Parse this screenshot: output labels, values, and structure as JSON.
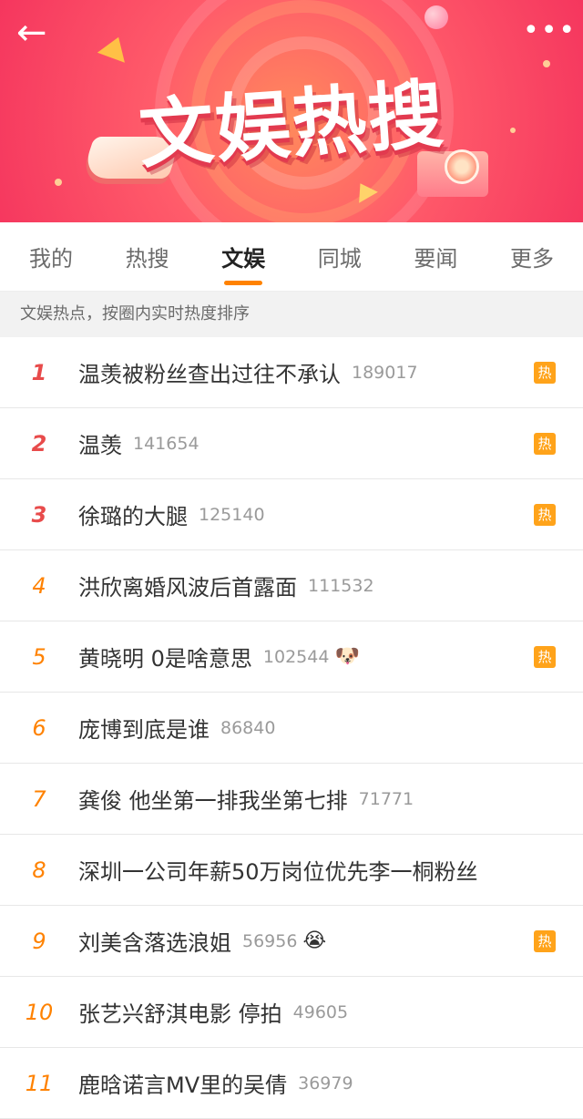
{
  "banner": {
    "title": "文娱热搜",
    "back_icon": "←",
    "more_icon": "•••"
  },
  "tabs": [
    {
      "label": "我的",
      "active": false
    },
    {
      "label": "热搜",
      "active": false
    },
    {
      "label": "文娱",
      "active": true
    },
    {
      "label": "同城",
      "active": false
    },
    {
      "label": "要闻",
      "active": false
    },
    {
      "label": "更多",
      "active": false
    }
  ],
  "subheader": "文娱热点，按圈内实时热度排序",
  "hot_badge_label": "热",
  "items": [
    {
      "rank": "1",
      "title": "温羡被粉丝查出过往不承认",
      "count": "189017",
      "emoji": "",
      "hot": true
    },
    {
      "rank": "2",
      "title": "温羡",
      "count": "141654",
      "emoji": "",
      "hot": true
    },
    {
      "rank": "3",
      "title": "徐璐的大腿",
      "count": "125140",
      "emoji": "",
      "hot": true
    },
    {
      "rank": "4",
      "title": "洪欣离婚风波后首露面",
      "count": "111532",
      "emoji": "",
      "hot": false
    },
    {
      "rank": "5",
      "title": "黄晓明 0是啥意思",
      "count": "102544",
      "emoji": "🐶",
      "hot": true
    },
    {
      "rank": "6",
      "title": "庞博到底是谁",
      "count": "86840",
      "emoji": "",
      "hot": false
    },
    {
      "rank": "7",
      "title": "龚俊 他坐第一排我坐第七排",
      "count": "71771",
      "emoji": "",
      "hot": false
    },
    {
      "rank": "8",
      "title": "深圳一公司年薪50万岗位优先李一桐粉丝",
      "count": "",
      "emoji": "",
      "hot": false
    },
    {
      "rank": "9",
      "title": "刘美含落选浪姐",
      "count": "56956",
      "emoji": "😭",
      "hot": true
    },
    {
      "rank": "10",
      "title": "张艺兴舒淇电影 停拍",
      "count": "49605",
      "emoji": "",
      "hot": false
    },
    {
      "rank": "11",
      "title": "鹿晗诺言MV里的吴倩",
      "count": "36979",
      "emoji": "",
      "hot": false
    }
  ],
  "colors": {
    "accent": "#ff8200",
    "top_rank": "#e84b4b",
    "hot_badge": "#ffa31a",
    "banner_pink": "#f5365e"
  }
}
